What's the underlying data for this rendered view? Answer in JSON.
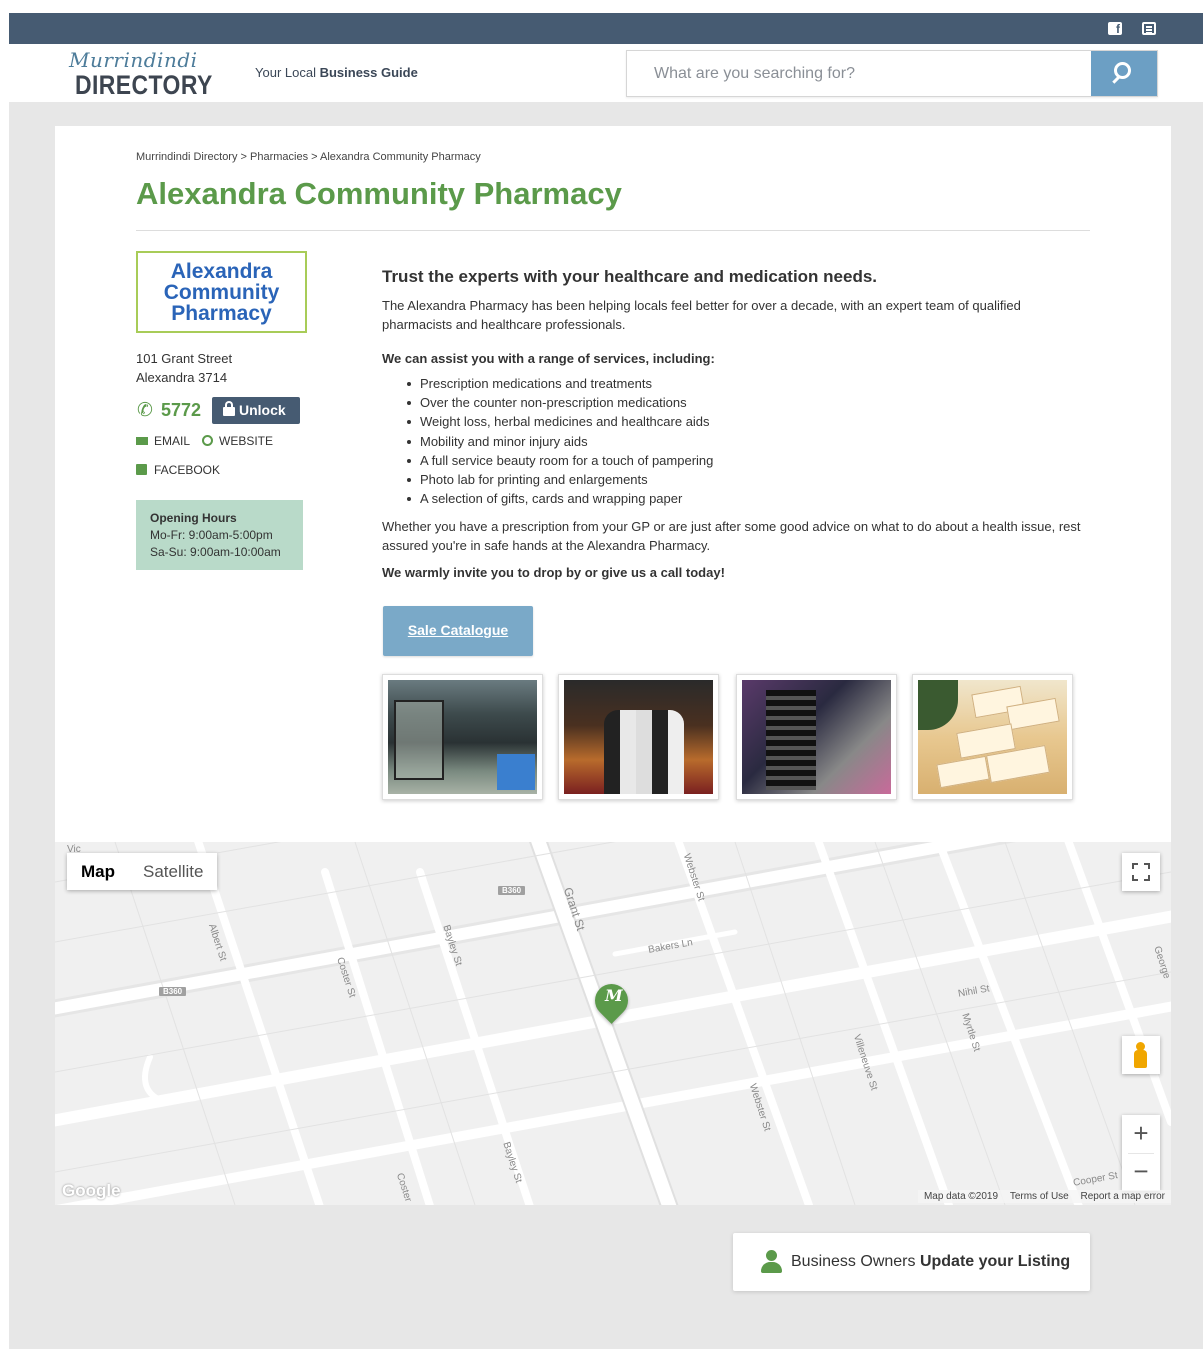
{
  "topbar": {
    "icons": [
      "facebook-icon",
      "newsletter-icon"
    ]
  },
  "header": {
    "logo_script": "Murrindindi",
    "logo_main": "DIRECTORY",
    "tagline_prefix": "Your Local",
    "tagline_bold": "Business Guide",
    "search_placeholder": "What are you searching for?"
  },
  "breadcrumb": "Murrindindi Directory > Pharmacies > Alexandra Community Pharmacy",
  "business": {
    "name": "Alexandra Community Pharmacy",
    "logo_lines": [
      "Alexandra",
      "Community",
      "Pharmacy"
    ],
    "address_line1": "101 Grant Street",
    "address_line2": "Alexandra 3714",
    "phone_partial": "5772",
    "unlock_label": "Unlock",
    "email_label": "EMAIL",
    "website_label": "WEBSITE",
    "facebook_label": "FACEBOOK",
    "hours_title": "Opening Hours",
    "hours_weekday": "Mo-Fr: 9:00am-5:00pm",
    "hours_weekend": "Sa-Su: 9:00am-10:00am"
  },
  "description": {
    "lead": "Trust the experts with your healthcare and medication needs.",
    "intro": "The Alexandra Pharmacy has been helping locals feel better for over a decade, with an expert team of qualified pharmacists and healthcare professionals.",
    "services_heading": "We can assist you with a range of services, including:",
    "services": [
      "Prescription medications and treatments",
      "Over the counter non-prescription medications",
      "Weight loss, herbal medicines and healthcare aids",
      "Mobility and minor injury aids",
      "A full service beauty room for a touch of pampering",
      "Photo lab for printing and enlargements",
      "A selection of gifts, cards and wrapping paper"
    ],
    "closing": "Whether you have a prescription from your GP or are just after some good advice on what to do about a health issue, rest assured you're in safe hands at the Alexandra Pharmacy.",
    "invite": "We warmly invite you to drop by or give us a call today!"
  },
  "sale_catalogue_label": "Sale Catalogue",
  "gallery": {
    "count": 4
  },
  "map": {
    "type_map": "Map",
    "type_satellite": "Satellite",
    "marker_letter": "M",
    "streets": {
      "grant": "Grant St",
      "webster_top": "Webster St",
      "webster_bottom": "Webster St",
      "bakers": "Bakers Ln",
      "albert": "Albert St",
      "bayley_top": "Bayley St",
      "bayley_bottom": "Bayley St",
      "coster_top": "Coster St",
      "coster_bottom": "Coster",
      "nihil": "Nihil St",
      "myrtle": "Myrtle St",
      "villeneuve": "Villeneuve St",
      "cooper": "Cooper St",
      "george": "George",
      "vic": "Vic"
    },
    "shield_top": "B360",
    "shield_left": "B360",
    "zoom_in": "+",
    "zoom_out": "−",
    "google_logo": "Google",
    "attrib_data": "Map data ©2019",
    "attrib_terms": "Terms of Use",
    "attrib_report": "Report a map error"
  },
  "owner_cta": {
    "prefix": "Business Owners",
    "bold": "Update your Listing"
  },
  "colors": {
    "navy": "#465b72",
    "green": "#5b9a4a",
    "blue_button": "#6c9fc4"
  }
}
